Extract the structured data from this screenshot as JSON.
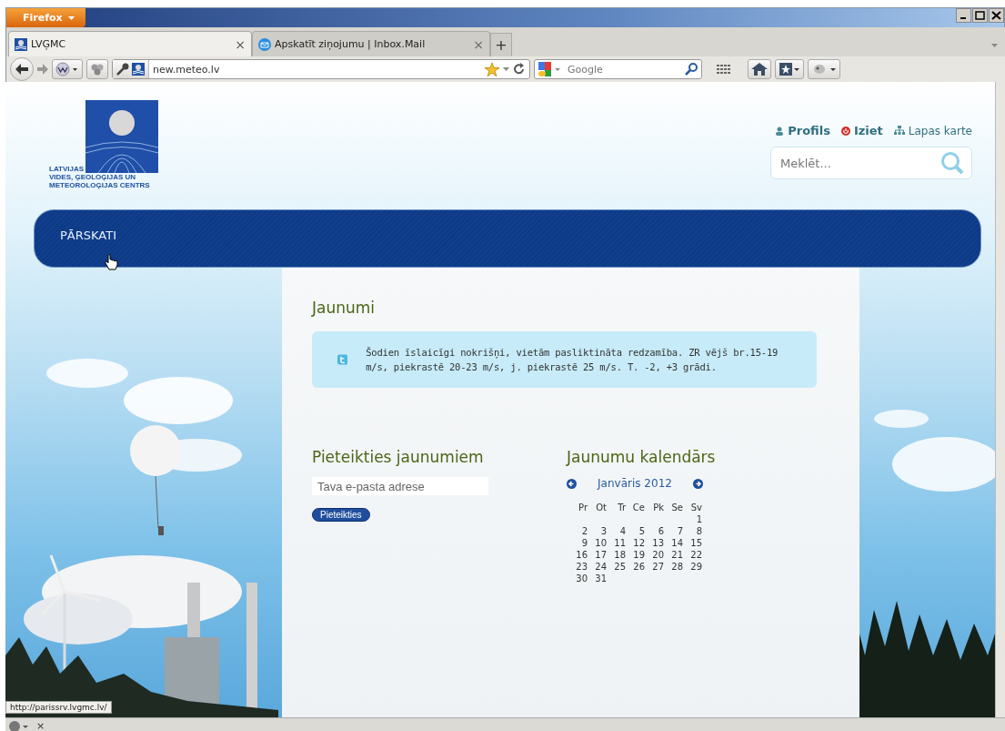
{
  "browser": {
    "menu_button": "Firefox",
    "tabs": [
      {
        "title": "LVĢMC",
        "close": "×",
        "selected": true
      },
      {
        "title": "Apskatīt ziņojumu | Inbox.Mail",
        "close": "×",
        "selected": false
      }
    ],
    "new_tab": "+",
    "url": "new.meteo.lv",
    "search_placeholder": "Google"
  },
  "site": {
    "logo_lines": [
      "LATVIJAS",
      "VIDES, ĢEOLOĢIJAS UN",
      "METEOROLOĢIJAS CENTRS"
    ],
    "top_links": [
      {
        "kind": "profile",
        "label": "Profils"
      },
      {
        "kind": "logout",
        "label": "Iziet"
      },
      {
        "kind": "sitemap",
        "label": "Lapas karte"
      }
    ],
    "search_placeholder": "Meklēt...",
    "nav": [
      {
        "label": "PĀRSKATI"
      }
    ],
    "news": {
      "title": "Jaunumi",
      "text": "Šodien īslaicīgi nokrišņi, vietām pasliktināta redzamība. ZR vējš br.15-19 m/s, piekrastē 20-23 m/s, j. piekrastē 25 m/s. T. -2, +3 grādi."
    },
    "subscribe": {
      "title": "Pieteikties jaunumiem",
      "placeholder": "Tava e-pasta adrese",
      "button": "Pieteikties"
    },
    "calendar": {
      "title": "Jaunumu kalendārs",
      "month": "Janvāris 2012",
      "weekdays": [
        "Pr",
        "Ot",
        "Tr",
        "Ce",
        "Pk",
        "Se",
        "Sv"
      ],
      "weeks": [
        [
          "1"
        ],
        [
          "2",
          "3",
          "4",
          "5",
          "6",
          "7",
          "8"
        ],
        [
          "9",
          "10",
          "11",
          "12",
          "13",
          "14",
          "15"
        ],
        [
          "16",
          "17",
          "18",
          "19",
          "20",
          "21",
          "22"
        ],
        [
          "23",
          "24",
          "25",
          "26",
          "27",
          "28",
          "29"
        ],
        [
          "30",
          "31"
        ]
      ]
    }
  },
  "status_url": "http://parissrv.lvgmc.lv/",
  "addon_bar": {
    "close": "×"
  }
}
